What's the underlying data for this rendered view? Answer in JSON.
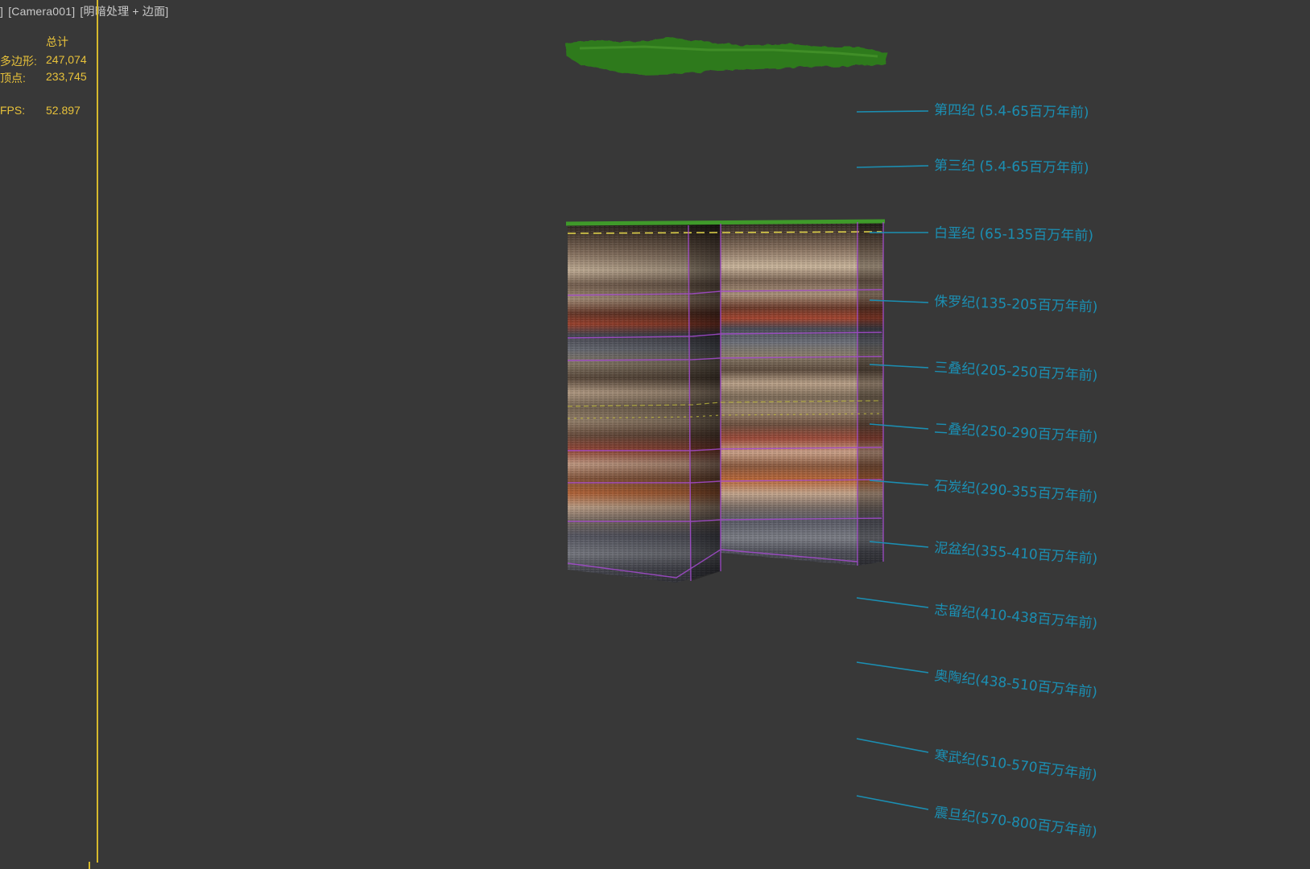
{
  "viewport": {
    "label_bracket_open": "]",
    "camera": "[Camera001]",
    "shading": "[明暗处理 + 边面]"
  },
  "stats": {
    "header": "总计",
    "polygons_label": "多边形:",
    "polygons_value": "247,074",
    "vertices_label": "顶点:",
    "vertices_value": "233,745",
    "fps_label": "FPS:",
    "fps_value": "52.897"
  },
  "colors": {
    "background": "#383838",
    "stats_text": "#e8c23a",
    "annotation": "#1b8fb3",
    "grass": "#2f7a1e"
  },
  "annotations": [
    "第四纪 (5.4-65百万年前)",
    "第三纪 (5.4-65百万年前)",
    "白垩纪 (65-135百万年前)",
    "侏罗纪(135-205百万年前)",
    "三叠纪(205-250百万年前)",
    "二叠纪(250-290百万年前)",
    "石炭纪(290-355百万年前)",
    "泥盆纪(355-410百万年前)",
    "志留纪(410-438百万年前)",
    "奥陶纪(438-510百万年前)",
    "寒武纪(510-570百万年前)",
    "震旦纪(570-800百万年前)"
  ]
}
